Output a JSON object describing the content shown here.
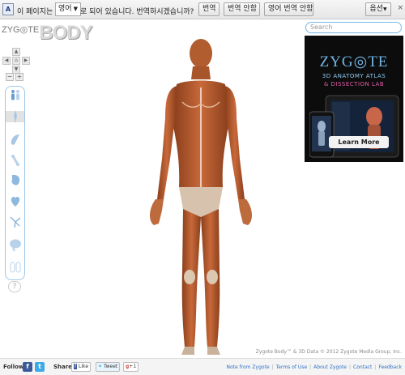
{
  "translate_bar": {
    "icon": "translate-icon",
    "icon_text": "A",
    "text_before": "이 페이지는",
    "language": "영어",
    "text_after": "로 되어 있습니다. 번역하시겠습니까?",
    "translate_button": "번역",
    "no_translate_button": "번역 안함",
    "never_translate_button": "영어 번역 안함",
    "options_button": "옵션",
    "close": "×"
  },
  "app": {
    "logo_prefix": "ZYG◎TE",
    "logo_word": "BODY",
    "search_placeholder": "Search",
    "zoom_out": "−",
    "zoom_in": "+",
    "help": "?",
    "copyright": "Zygote Body™ & 3D Data © 2012 Zygote Media Group, Inc."
  },
  "ad": {
    "brand": "ZYG◎TE",
    "line1": "3D ANATOMY ATLAS",
    "line2": "& DISSECTION LAB",
    "cta": "Learn More"
  },
  "footer": {
    "follow_label": "Follow",
    "share_label": "Share",
    "like": "Like",
    "tweet": "Tweet",
    "plus_one": "+1",
    "links": [
      "Note from Zygote",
      "Terms of Use",
      "About Zygote",
      "Contact",
      "Feedback"
    ]
  },
  "colors": {
    "accent": "#9cc7ea",
    "facebook": "#3b5998",
    "twitter": "#3fa9e8",
    "gplus": "#d4473a",
    "link": "#2f72c4"
  }
}
